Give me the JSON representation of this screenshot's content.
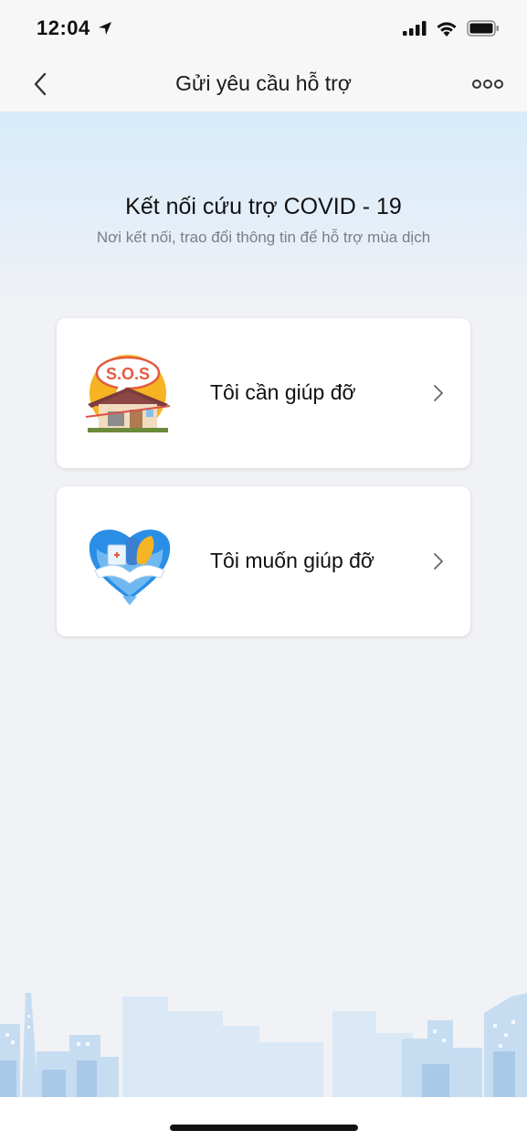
{
  "status_bar": {
    "time": "12:04"
  },
  "header": {
    "title": "Gửi yêu cầu hỗ trợ"
  },
  "hero": {
    "title": "Kết nối cứu trợ COVID - 19",
    "subtitle": "Nơi kết nối, trao đổi thông tin để hỗ trợ mùa dịch"
  },
  "cards": [
    {
      "label": "Tôi cần giúp đỡ",
      "icon": "sos-house-icon",
      "badge_text": "S.O.S"
    },
    {
      "label": "Tôi muốn giúp đỡ",
      "icon": "heart-hands-icon"
    }
  ],
  "colors": {
    "accent_blue": "#2a8ee6",
    "sos_red": "#e45b3f",
    "sos_yellow": "#f6b322"
  }
}
